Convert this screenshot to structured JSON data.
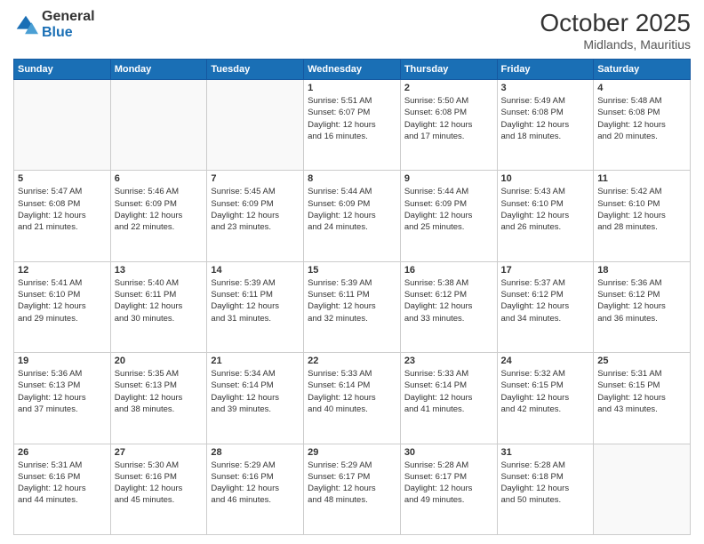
{
  "header": {
    "logo": {
      "general": "General",
      "blue": "Blue"
    },
    "title": "October 2025",
    "location": "Midlands, Mauritius"
  },
  "calendar": {
    "days": [
      "Sunday",
      "Monday",
      "Tuesday",
      "Wednesday",
      "Thursday",
      "Friday",
      "Saturday"
    ],
    "weeks": [
      [
        {
          "day": "",
          "info": ""
        },
        {
          "day": "",
          "info": ""
        },
        {
          "day": "",
          "info": ""
        },
        {
          "day": "1",
          "info": "Sunrise: 5:51 AM\nSunset: 6:07 PM\nDaylight: 12 hours\nand 16 minutes."
        },
        {
          "day": "2",
          "info": "Sunrise: 5:50 AM\nSunset: 6:08 PM\nDaylight: 12 hours\nand 17 minutes."
        },
        {
          "day": "3",
          "info": "Sunrise: 5:49 AM\nSunset: 6:08 PM\nDaylight: 12 hours\nand 18 minutes."
        },
        {
          "day": "4",
          "info": "Sunrise: 5:48 AM\nSunset: 6:08 PM\nDaylight: 12 hours\nand 20 minutes."
        }
      ],
      [
        {
          "day": "5",
          "info": "Sunrise: 5:47 AM\nSunset: 6:08 PM\nDaylight: 12 hours\nand 21 minutes."
        },
        {
          "day": "6",
          "info": "Sunrise: 5:46 AM\nSunset: 6:09 PM\nDaylight: 12 hours\nand 22 minutes."
        },
        {
          "day": "7",
          "info": "Sunrise: 5:45 AM\nSunset: 6:09 PM\nDaylight: 12 hours\nand 23 minutes."
        },
        {
          "day": "8",
          "info": "Sunrise: 5:44 AM\nSunset: 6:09 PM\nDaylight: 12 hours\nand 24 minutes."
        },
        {
          "day": "9",
          "info": "Sunrise: 5:44 AM\nSunset: 6:09 PM\nDaylight: 12 hours\nand 25 minutes."
        },
        {
          "day": "10",
          "info": "Sunrise: 5:43 AM\nSunset: 6:10 PM\nDaylight: 12 hours\nand 26 minutes."
        },
        {
          "day": "11",
          "info": "Sunrise: 5:42 AM\nSunset: 6:10 PM\nDaylight: 12 hours\nand 28 minutes."
        }
      ],
      [
        {
          "day": "12",
          "info": "Sunrise: 5:41 AM\nSunset: 6:10 PM\nDaylight: 12 hours\nand 29 minutes."
        },
        {
          "day": "13",
          "info": "Sunrise: 5:40 AM\nSunset: 6:11 PM\nDaylight: 12 hours\nand 30 minutes."
        },
        {
          "day": "14",
          "info": "Sunrise: 5:39 AM\nSunset: 6:11 PM\nDaylight: 12 hours\nand 31 minutes."
        },
        {
          "day": "15",
          "info": "Sunrise: 5:39 AM\nSunset: 6:11 PM\nDaylight: 12 hours\nand 32 minutes."
        },
        {
          "day": "16",
          "info": "Sunrise: 5:38 AM\nSunset: 6:12 PM\nDaylight: 12 hours\nand 33 minutes."
        },
        {
          "day": "17",
          "info": "Sunrise: 5:37 AM\nSunset: 6:12 PM\nDaylight: 12 hours\nand 34 minutes."
        },
        {
          "day": "18",
          "info": "Sunrise: 5:36 AM\nSunset: 6:12 PM\nDaylight: 12 hours\nand 36 minutes."
        }
      ],
      [
        {
          "day": "19",
          "info": "Sunrise: 5:36 AM\nSunset: 6:13 PM\nDaylight: 12 hours\nand 37 minutes."
        },
        {
          "day": "20",
          "info": "Sunrise: 5:35 AM\nSunset: 6:13 PM\nDaylight: 12 hours\nand 38 minutes."
        },
        {
          "day": "21",
          "info": "Sunrise: 5:34 AM\nSunset: 6:14 PM\nDaylight: 12 hours\nand 39 minutes."
        },
        {
          "day": "22",
          "info": "Sunrise: 5:33 AM\nSunset: 6:14 PM\nDaylight: 12 hours\nand 40 minutes."
        },
        {
          "day": "23",
          "info": "Sunrise: 5:33 AM\nSunset: 6:14 PM\nDaylight: 12 hours\nand 41 minutes."
        },
        {
          "day": "24",
          "info": "Sunrise: 5:32 AM\nSunset: 6:15 PM\nDaylight: 12 hours\nand 42 minutes."
        },
        {
          "day": "25",
          "info": "Sunrise: 5:31 AM\nSunset: 6:15 PM\nDaylight: 12 hours\nand 43 minutes."
        }
      ],
      [
        {
          "day": "26",
          "info": "Sunrise: 5:31 AM\nSunset: 6:16 PM\nDaylight: 12 hours\nand 44 minutes."
        },
        {
          "day": "27",
          "info": "Sunrise: 5:30 AM\nSunset: 6:16 PM\nDaylight: 12 hours\nand 45 minutes."
        },
        {
          "day": "28",
          "info": "Sunrise: 5:29 AM\nSunset: 6:16 PM\nDaylight: 12 hours\nand 46 minutes."
        },
        {
          "day": "29",
          "info": "Sunrise: 5:29 AM\nSunset: 6:17 PM\nDaylight: 12 hours\nand 48 minutes."
        },
        {
          "day": "30",
          "info": "Sunrise: 5:28 AM\nSunset: 6:17 PM\nDaylight: 12 hours\nand 49 minutes."
        },
        {
          "day": "31",
          "info": "Sunrise: 5:28 AM\nSunset: 6:18 PM\nDaylight: 12 hours\nand 50 minutes."
        },
        {
          "day": "",
          "info": ""
        }
      ]
    ]
  }
}
